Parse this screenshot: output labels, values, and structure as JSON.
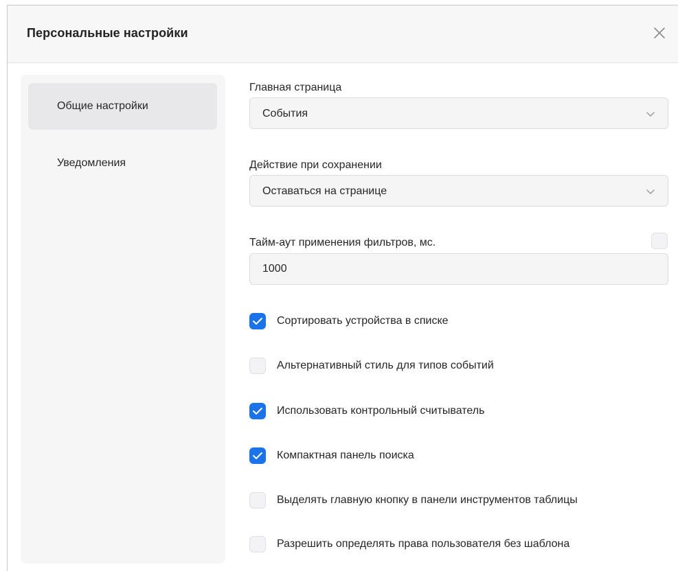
{
  "dialog": {
    "title": "Персональные настройки"
  },
  "sidebar": {
    "items": [
      {
        "label": "Общие настройки",
        "active": true
      },
      {
        "label": "Уведомления",
        "active": false
      }
    ]
  },
  "settings": {
    "home_page": {
      "label": "Главная страница",
      "value": "События"
    },
    "save_action": {
      "label": "Действие при сохранении",
      "value": "Оставаться на странице"
    },
    "filter_timeout": {
      "label": "Тайм-аут применения фильтров, мс.",
      "value": "1000",
      "enabled": false
    },
    "checkboxes": [
      {
        "label": "Сортировать устройства в списке",
        "checked": true
      },
      {
        "label": "Альтернативный стиль для типов событий",
        "checked": false
      },
      {
        "label": "Использовать контрольный считыватель",
        "checked": true
      },
      {
        "label": "Компактная панель поиска",
        "checked": true
      },
      {
        "label": "Выделять главную кнопку в панели инструментов таблицы",
        "checked": false
      },
      {
        "label": "Разрешить определять права пользователя без шаблона",
        "checked": false
      }
    ]
  },
  "colors": {
    "accent": "#1a73e8",
    "header_bg": "#f7f7f8",
    "sidebar_bg": "#f6f6f7"
  }
}
